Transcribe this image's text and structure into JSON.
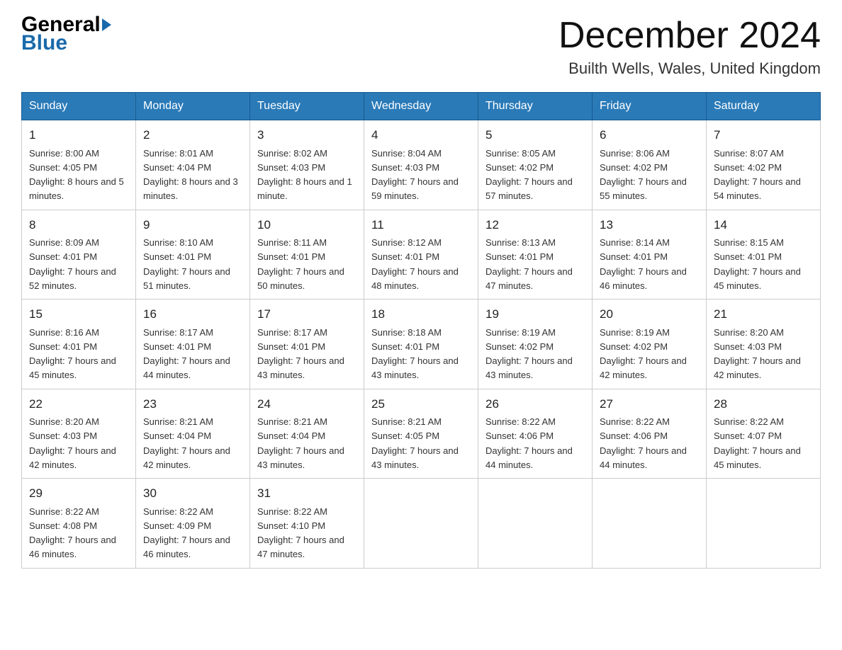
{
  "header": {
    "logo_general": "General",
    "logo_blue": "Blue",
    "month_title": "December 2024",
    "location": "Builth Wells, Wales, United Kingdom"
  },
  "days_of_week": [
    "Sunday",
    "Monday",
    "Tuesday",
    "Wednesday",
    "Thursday",
    "Friday",
    "Saturday"
  ],
  "weeks": [
    [
      {
        "day": "1",
        "sunrise": "8:00 AM",
        "sunset": "4:05 PM",
        "daylight": "8 hours and 5 minutes."
      },
      {
        "day": "2",
        "sunrise": "8:01 AM",
        "sunset": "4:04 PM",
        "daylight": "8 hours and 3 minutes."
      },
      {
        "day": "3",
        "sunrise": "8:02 AM",
        "sunset": "4:03 PM",
        "daylight": "8 hours and 1 minute."
      },
      {
        "day": "4",
        "sunrise": "8:04 AM",
        "sunset": "4:03 PM",
        "daylight": "7 hours and 59 minutes."
      },
      {
        "day": "5",
        "sunrise": "8:05 AM",
        "sunset": "4:02 PM",
        "daylight": "7 hours and 57 minutes."
      },
      {
        "day": "6",
        "sunrise": "8:06 AM",
        "sunset": "4:02 PM",
        "daylight": "7 hours and 55 minutes."
      },
      {
        "day": "7",
        "sunrise": "8:07 AM",
        "sunset": "4:02 PM",
        "daylight": "7 hours and 54 minutes."
      }
    ],
    [
      {
        "day": "8",
        "sunrise": "8:09 AM",
        "sunset": "4:01 PM",
        "daylight": "7 hours and 52 minutes."
      },
      {
        "day": "9",
        "sunrise": "8:10 AM",
        "sunset": "4:01 PM",
        "daylight": "7 hours and 51 minutes."
      },
      {
        "day": "10",
        "sunrise": "8:11 AM",
        "sunset": "4:01 PM",
        "daylight": "7 hours and 50 minutes."
      },
      {
        "day": "11",
        "sunrise": "8:12 AM",
        "sunset": "4:01 PM",
        "daylight": "7 hours and 48 minutes."
      },
      {
        "day": "12",
        "sunrise": "8:13 AM",
        "sunset": "4:01 PM",
        "daylight": "7 hours and 47 minutes."
      },
      {
        "day": "13",
        "sunrise": "8:14 AM",
        "sunset": "4:01 PM",
        "daylight": "7 hours and 46 minutes."
      },
      {
        "day": "14",
        "sunrise": "8:15 AM",
        "sunset": "4:01 PM",
        "daylight": "7 hours and 45 minutes."
      }
    ],
    [
      {
        "day": "15",
        "sunrise": "8:16 AM",
        "sunset": "4:01 PM",
        "daylight": "7 hours and 45 minutes."
      },
      {
        "day": "16",
        "sunrise": "8:17 AM",
        "sunset": "4:01 PM",
        "daylight": "7 hours and 44 minutes."
      },
      {
        "day": "17",
        "sunrise": "8:17 AM",
        "sunset": "4:01 PM",
        "daylight": "7 hours and 43 minutes."
      },
      {
        "day": "18",
        "sunrise": "8:18 AM",
        "sunset": "4:01 PM",
        "daylight": "7 hours and 43 minutes."
      },
      {
        "day": "19",
        "sunrise": "8:19 AM",
        "sunset": "4:02 PM",
        "daylight": "7 hours and 43 minutes."
      },
      {
        "day": "20",
        "sunrise": "8:19 AM",
        "sunset": "4:02 PM",
        "daylight": "7 hours and 42 minutes."
      },
      {
        "day": "21",
        "sunrise": "8:20 AM",
        "sunset": "4:03 PM",
        "daylight": "7 hours and 42 minutes."
      }
    ],
    [
      {
        "day": "22",
        "sunrise": "8:20 AM",
        "sunset": "4:03 PM",
        "daylight": "7 hours and 42 minutes."
      },
      {
        "day": "23",
        "sunrise": "8:21 AM",
        "sunset": "4:04 PM",
        "daylight": "7 hours and 42 minutes."
      },
      {
        "day": "24",
        "sunrise": "8:21 AM",
        "sunset": "4:04 PM",
        "daylight": "7 hours and 43 minutes."
      },
      {
        "day": "25",
        "sunrise": "8:21 AM",
        "sunset": "4:05 PM",
        "daylight": "7 hours and 43 minutes."
      },
      {
        "day": "26",
        "sunrise": "8:22 AM",
        "sunset": "4:06 PM",
        "daylight": "7 hours and 44 minutes."
      },
      {
        "day": "27",
        "sunrise": "8:22 AM",
        "sunset": "4:06 PM",
        "daylight": "7 hours and 44 minutes."
      },
      {
        "day": "28",
        "sunrise": "8:22 AM",
        "sunset": "4:07 PM",
        "daylight": "7 hours and 45 minutes."
      }
    ],
    [
      {
        "day": "29",
        "sunrise": "8:22 AM",
        "sunset": "4:08 PM",
        "daylight": "7 hours and 46 minutes."
      },
      {
        "day": "30",
        "sunrise": "8:22 AM",
        "sunset": "4:09 PM",
        "daylight": "7 hours and 46 minutes."
      },
      {
        "day": "31",
        "sunrise": "8:22 AM",
        "sunset": "4:10 PM",
        "daylight": "7 hours and 47 minutes."
      },
      null,
      null,
      null,
      null
    ]
  ]
}
